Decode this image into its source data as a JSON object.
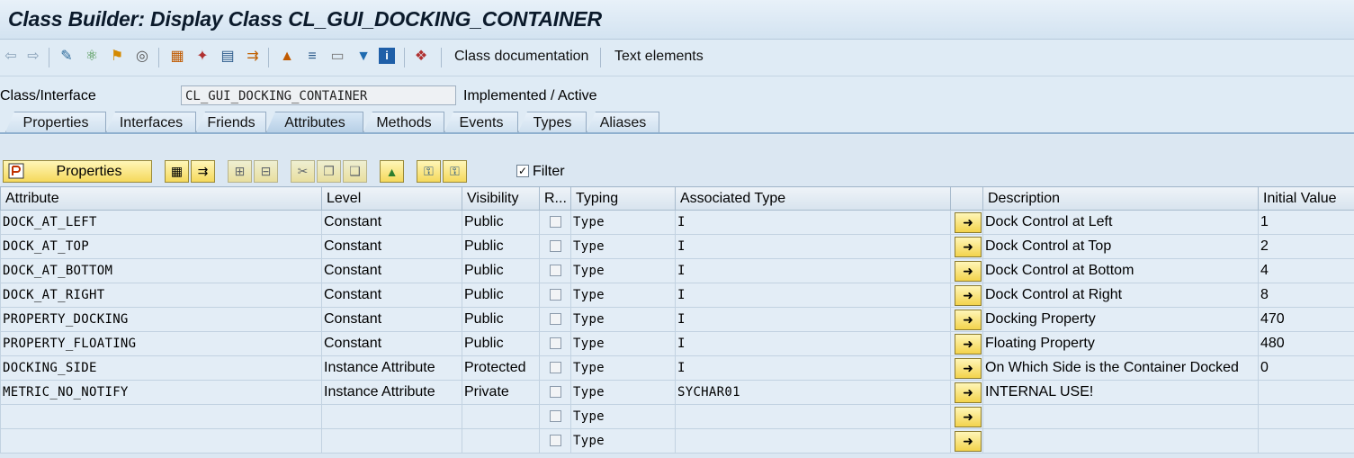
{
  "window": {
    "title": "Class Builder: Display Class CL_GUI_DOCKING_CONTAINER"
  },
  "toolbar": {
    "icons": [
      "back-arrow-icon",
      "forward-arrow-icon",
      "toggle-display-change-icon",
      "activate-icon",
      "where-used-icon",
      "object-list-icon",
      "hierarchy-icon",
      "magic-wand-icon",
      "test-icon",
      "display-object-icon",
      "local-types-icon",
      "implementation-icon",
      "text-icon",
      "filter-icon",
      "info-icon",
      "window-icon"
    ],
    "class_documentation": "Class documentation",
    "text_elements": "Text elements"
  },
  "class_interface": {
    "label": "Class/Interface",
    "value": "CL_GUI_DOCKING_CONTAINER",
    "status": "Implemented / Active"
  },
  "tabs": [
    "Properties",
    "Interfaces",
    "Friends",
    "Attributes",
    "Methods",
    "Events",
    "Types",
    "Aliases"
  ],
  "active_tab": "Attributes",
  "attr_toolbar": {
    "properties_label": "Properties",
    "filter_label": "Filter",
    "filter_checked": true
  },
  "columns": [
    "Attribute",
    "Level",
    "Visibility",
    "R...",
    "Typing",
    "Associated Type",
    "",
    "Description",
    "Initial Value"
  ],
  "rows": [
    {
      "attribute": "DOCK_AT_LEFT",
      "level": "Constant",
      "visibility": "Public",
      "typing": "Type",
      "assoc": "I",
      "desc": "Dock Control at Left",
      "init": "1"
    },
    {
      "attribute": "DOCK_AT_TOP",
      "level": "Constant",
      "visibility": "Public",
      "typing": "Type",
      "assoc": "I",
      "desc": "Dock Control at Top",
      "init": "2"
    },
    {
      "attribute": "DOCK_AT_BOTTOM",
      "level": "Constant",
      "visibility": "Public",
      "typing": "Type",
      "assoc": "I",
      "desc": "Dock Control at Bottom",
      "init": "4"
    },
    {
      "attribute": "DOCK_AT_RIGHT",
      "level": "Constant",
      "visibility": "Public",
      "typing": "Type",
      "assoc": "I",
      "desc": "Dock Control at Right",
      "init": "8"
    },
    {
      "attribute": "PROPERTY_DOCKING",
      "level": "Constant",
      "visibility": "Public",
      "typing": "Type",
      "assoc": "I",
      "desc": "Docking Property",
      "init": "470"
    },
    {
      "attribute": "PROPERTY_FLOATING",
      "level": "Constant",
      "visibility": "Public",
      "typing": "Type",
      "assoc": "I",
      "desc": "Floating Property",
      "init": "480"
    },
    {
      "attribute": "DOCKING_SIDE",
      "level": "Instance Attribute",
      "visibility": "Protected",
      "typing": "Type",
      "assoc": "I",
      "desc": "On Which Side is the Container Docked",
      "init": "0"
    },
    {
      "attribute": "METRIC_NO_NOTIFY",
      "level": "Instance Attribute",
      "visibility": "Private",
      "typing": "Type",
      "assoc": "SYCHAR01",
      "desc": "INTERNAL USE!",
      "init": ""
    },
    {
      "attribute": "",
      "level": "",
      "visibility": "",
      "typing": "Type",
      "assoc": "",
      "desc": "",
      "init": ""
    },
    {
      "attribute": "",
      "level": "",
      "visibility": "",
      "typing": "Type",
      "assoc": "",
      "desc": "",
      "init": ""
    }
  ]
}
